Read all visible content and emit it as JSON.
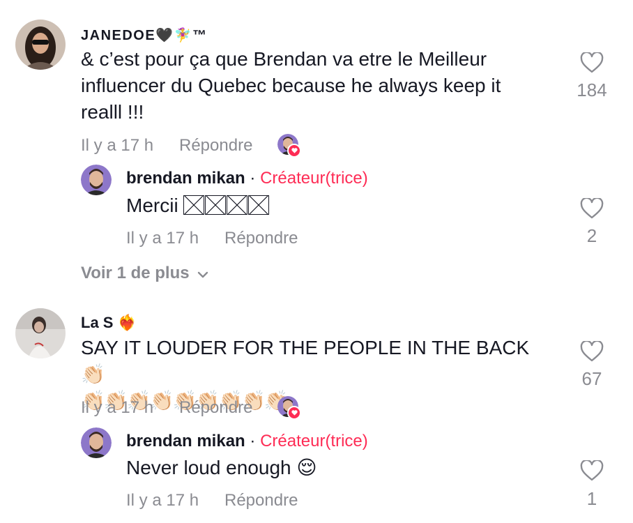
{
  "comments": [
    {
      "username": "JANEDOE🖤🧚‍♀️™",
      "text": "& c’est pour ça que Brendan va etre le Meilleur influencer du Quebec because he always keep it realll !!!",
      "time": "Il y a 17 h",
      "reply": "Répondre",
      "likes": "184",
      "reply_item": {
        "username": "brendan mikan",
        "separator": "·",
        "role": "Créateur(trice)",
        "text": "Mercii",
        "time": "Il y a 17 h",
        "reply": "Répondre",
        "likes": "2"
      },
      "view_more": "Voir 1 de plus"
    },
    {
      "username": "La S",
      "username_emoji": "❤️‍🔥",
      "text": "SAY IT LOUDER FOR THE PEOPLE IN THE BACK 👏🏻",
      "text_line2": "👏🏻👏🏻👏🏻👏🏻👏🏻👏🏻👏🏻👏🏻👏🏻",
      "time": "Il y a 17 h",
      "reply": "Répondre",
      "likes": "67",
      "reply_item": {
        "username": "brendan mikan",
        "separator": "·",
        "role": "Créateur(trice)",
        "text": "Never loud enough 😌",
        "time": "Il y a 17 h",
        "reply": "Répondre",
        "likes": "1"
      }
    }
  ],
  "colors": {
    "creator_accent": "#fe2c55",
    "meta_gray": "#8a8b91",
    "text": "#161823"
  },
  "icons": {
    "like": "heart-outline-icon",
    "expand": "chevron-down-icon",
    "creator_liked": "heart-badge-icon"
  }
}
